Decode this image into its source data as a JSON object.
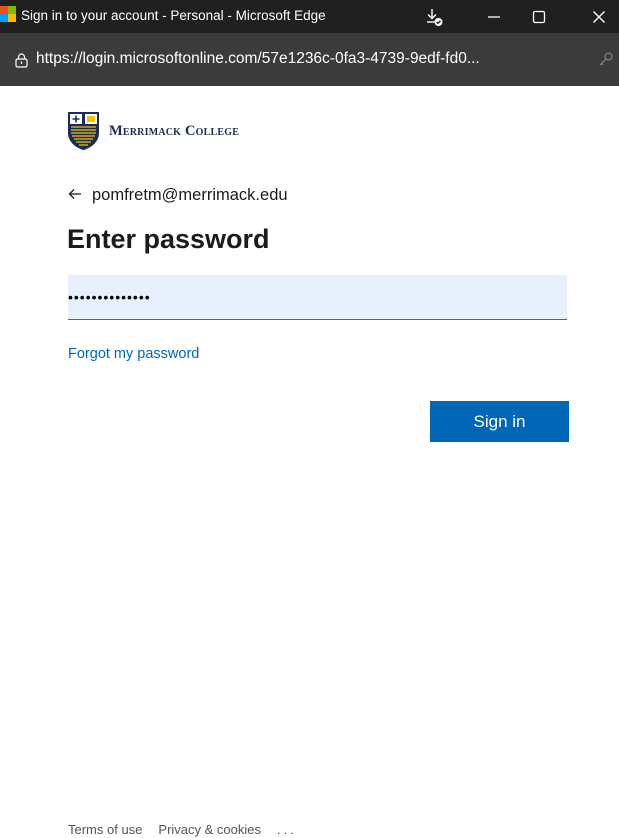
{
  "window": {
    "title": "Sign in to your account - Personal - Microsoft Edge",
    "app_icon": "microsoft-logo-icon",
    "controls": [
      "download-icon",
      "minimize-icon",
      "maximize-icon",
      "close-icon"
    ]
  },
  "address_bar": {
    "url": "https://login.microsoftonline.com/57e1236c-0fa3-4739-9edf-fd0...",
    "left_icon": "site-info-icon",
    "right_icon": "key-icon"
  },
  "org": {
    "name": "Merrimack College",
    "logo_icon": "merrimack-shield-icon",
    "brand_color": "#1b2c56"
  },
  "identity": {
    "back_icon": "back-arrow-icon",
    "email": "pomfretm@merrimack.edu"
  },
  "form": {
    "heading": "Enter password",
    "password_value": "••••••••••••••",
    "forgot_link": "Forgot my password",
    "submit_label": "Sign in",
    "accent_color": "#0067b8"
  },
  "footer": {
    "terms": "Terms of use",
    "privacy": "Privacy & cookies",
    "more": "..."
  }
}
